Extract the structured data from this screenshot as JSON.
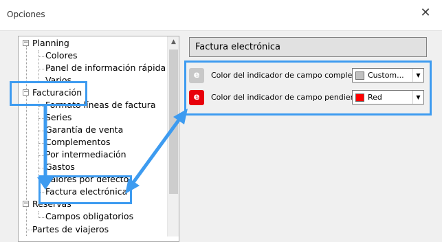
{
  "window": {
    "title": "Opciones",
    "close_glyph": "✕"
  },
  "tree": {
    "items": [
      {
        "label": "Planning",
        "expander": "−"
      },
      {
        "label": "Colores"
      },
      {
        "label": "Panel de información rápida"
      },
      {
        "label": "Varios"
      },
      {
        "label": "Facturación",
        "expander": "−"
      },
      {
        "label": "Formato líneas de factura"
      },
      {
        "label": "Series"
      },
      {
        "label": "Garantía de venta"
      },
      {
        "label": "Complementos"
      },
      {
        "label": "Por intermediación"
      },
      {
        "label": "Gastos"
      },
      {
        "label": "Valores por defecto"
      },
      {
        "label": "Factura electrónica"
      },
      {
        "label": "Reservas",
        "expander": "−"
      },
      {
        "label": "Campos obligatorios"
      },
      {
        "label": "Partes de viajeros"
      }
    ]
  },
  "scrollbar": {
    "up_glyph": "▲"
  },
  "panel": {
    "header": "Factura electrónica",
    "rows": [
      {
        "icon_letter": "e",
        "icon_color": "#c8c8c8",
        "label": "Color del indicador de campo completado",
        "value": "Custom...",
        "swatch": "#c0c0c0"
      },
      {
        "icon_letter": "e",
        "icon_color": "#e8000b",
        "label": "Color del indicador de campo pendiente",
        "value": "Red",
        "swatch": "#ff0000"
      }
    ],
    "dropdown_glyph": "▼"
  },
  "annotation_color": "#3d9bf0"
}
